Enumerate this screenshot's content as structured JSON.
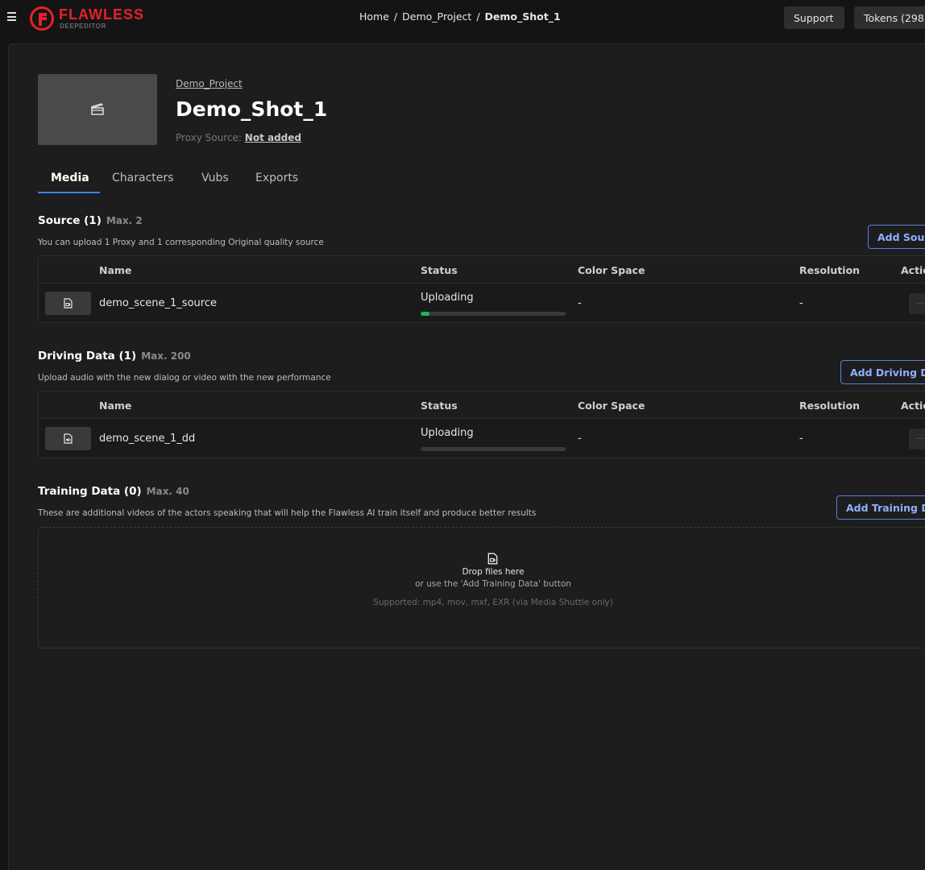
{
  "header": {
    "menu_icon": "hamburger-icon",
    "logo_text": "FLAWLESS",
    "logo_subtext": "DEEPEDITOR",
    "brand_color": "#e8202a",
    "breadcrumb": [
      "Home",
      "Demo_Project",
      "Demo_Shot_1"
    ],
    "breadcrumb_separator": "/",
    "support_label": "Support",
    "tokens_label": "Tokens (298"
  },
  "shot": {
    "project_link": "Demo_Project",
    "title": "Demo_Shot_1",
    "proxy_label": "Proxy Source:",
    "proxy_value": "Not added",
    "thumbnail_icon": "clapperboard-icon"
  },
  "tabs": [
    {
      "label": "Media",
      "active": true
    },
    {
      "label": "Characters",
      "active": false
    },
    {
      "label": "Vubs",
      "active": false
    },
    {
      "label": "Exports",
      "active": false
    }
  ],
  "columns": [
    "Name",
    "Status",
    "Color Space",
    "Resolution",
    "Actio"
  ],
  "source": {
    "title": "Source (1)",
    "max": "Max. 2",
    "description": "You can upload 1 Proxy and 1 corresponding Original quality source",
    "add_label": "Add Sour",
    "row": {
      "icon": "video-file-icon",
      "name": "demo_scene_1_source",
      "status": "Uploading",
      "progress": 0.06,
      "color_space": "-",
      "resolution": "-",
      "action": "..."
    }
  },
  "driving": {
    "title": "Driving Data (1)",
    "max": "Max. 200",
    "description": "Upload audio with the new dialog or video with the new performance",
    "add_label": "Add Driving Da",
    "row": {
      "icon": "audio-file-icon",
      "name": "demo_scene_1_dd",
      "status": "Uploading",
      "progress": 0,
      "color_space": "-",
      "resolution": "-",
      "action": "..."
    }
  },
  "training": {
    "title": "Training Data (0)",
    "max": "Max. 40",
    "description": "These are additional videos of the actors speaking that will help the Flawless AI train itself and produce better results",
    "add_label": "Add Training Da",
    "drop_icon": "video-file-icon",
    "drop_title": "Drop files here",
    "drop_hint": "or use the 'Add Training Data' button",
    "supported": "Supported: mp4, mov, mxf, EXR (via Media Shuttle only)"
  },
  "colors": {
    "accent": "#3b82f6",
    "button_border": "#5b7fe0",
    "progress_fill": "#22b45a"
  }
}
